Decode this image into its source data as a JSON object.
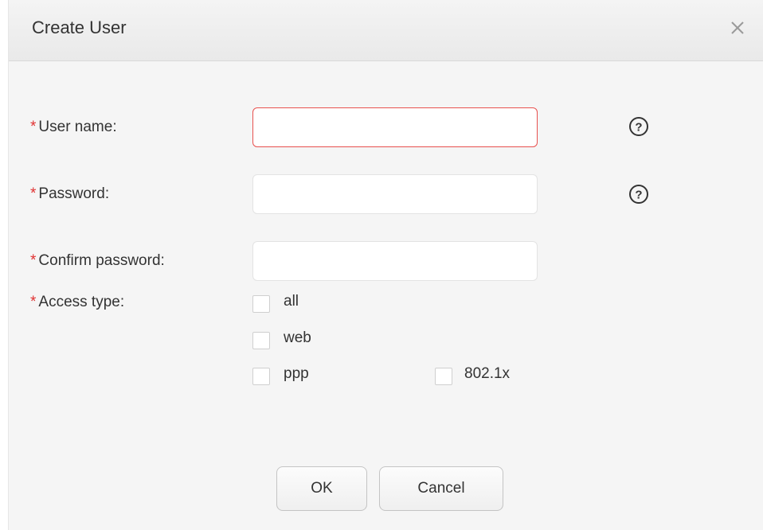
{
  "dialog": {
    "title": "Create User",
    "close_icon": "close-icon"
  },
  "form": {
    "required_marker": "*",
    "username": {
      "label": "User name:",
      "value": "",
      "placeholder": "",
      "state": "error",
      "help_icon": "help-circle-icon"
    },
    "password": {
      "label": "Password:",
      "value": "",
      "placeholder": "",
      "help_icon": "help-circle-icon"
    },
    "confirm_password": {
      "label": "Confirm password:",
      "value": "",
      "placeholder": ""
    },
    "access_type": {
      "label": "Access type:",
      "options": [
        {
          "label": "all",
          "checked": false
        },
        {
          "label": "web",
          "checked": false
        },
        {
          "label": "ppp",
          "checked": false
        },
        {
          "label": "802.1x",
          "checked": false
        }
      ]
    }
  },
  "buttons": {
    "ok_label": "OK",
    "cancel_label": "Cancel"
  },
  "colors": {
    "required": "#e03131",
    "error_border": "#e8514f",
    "dialog_bg": "#f5f5f5"
  }
}
